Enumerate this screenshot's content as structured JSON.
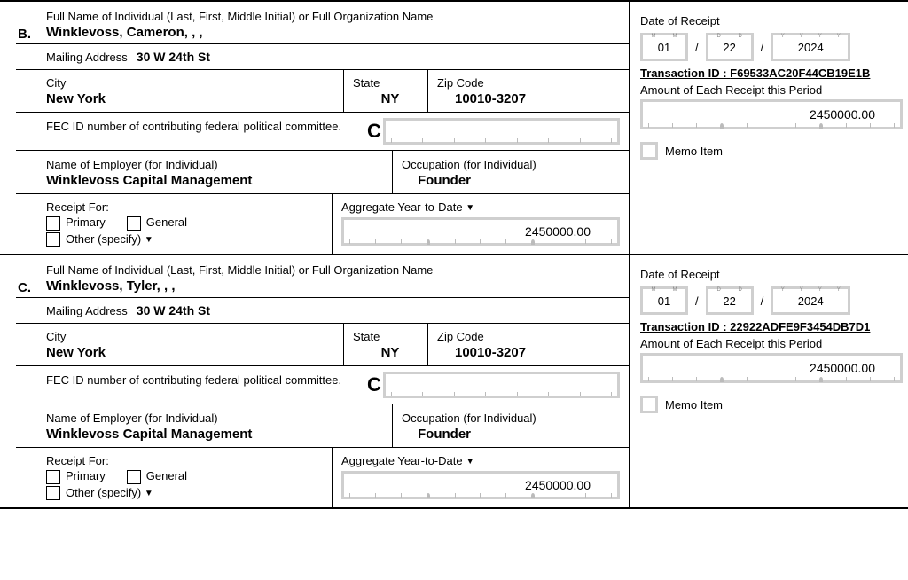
{
  "labels": {
    "full_name": "Full Name of Individual (Last, First, Middle Initial) or Full Organization Name",
    "mailing": "Mailing Address",
    "city": "City",
    "state": "State",
    "zip": "Zip Code",
    "fec": "FEC ID number of contributing federal political committee.",
    "employer": "Name of Employer (for Individual)",
    "occupation": "Occupation (for Individual)",
    "receipt_for": "Receipt For:",
    "primary": "Primary",
    "general": "General",
    "other": "Other (specify)",
    "aggregate": "Aggregate Year-to-Date",
    "date_of_receipt": "Date of Receipt",
    "transaction_id": "Transaction ID :",
    "amount": "Amount of Each Receipt this Period",
    "memo": "Memo Item",
    "c_prefix": "C"
  },
  "entries": [
    {
      "letter": "B.",
      "name": "Winklevoss, Cameron, , ,",
      "mailing": "30 W 24th St",
      "city": "New York",
      "state": "NY",
      "zip": "10010-3207",
      "employer": "Winklevoss Capital Management",
      "occupation": "Founder",
      "aggregate_ytd": "2450000.00",
      "date": {
        "mm": "01",
        "dd": "22",
        "yyyy": "2024"
      },
      "transaction_id": "F69533AC20F44CB19E1B",
      "amount": "2450000.00"
    },
    {
      "letter": "C.",
      "name": "Winklevoss, Tyler, , ,",
      "mailing": "30 W 24th St",
      "city": "New York",
      "state": "NY",
      "zip": "10010-3207",
      "employer": "Winklevoss Capital Management",
      "occupation": "Founder",
      "aggregate_ytd": "2450000.00",
      "date": {
        "mm": "01",
        "dd": "22",
        "yyyy": "2024"
      },
      "transaction_id": "22922ADFE9F3454DB7D1",
      "amount": "2450000.00"
    }
  ]
}
